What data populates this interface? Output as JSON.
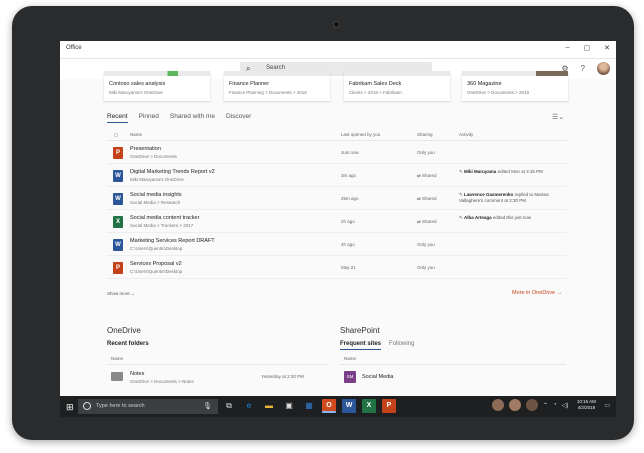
{
  "window": {
    "title": "Office",
    "controls": [
      "–",
      "▢",
      "✕"
    ]
  },
  "header": {
    "search_label": "Search",
    "search_icon": "search-icon",
    "icons": [
      "gear-icon",
      "help-icon"
    ],
    "help_glyph": "?",
    "gear_glyph": "⚙"
  },
  "recent_cards": [
    {
      "title": "Contoso sales analysis",
      "path": "Miki Maruyama's OneDrive"
    },
    {
      "title": "Finance Planner",
      "path": "Finance Planning > Documents > 2018"
    },
    {
      "title": "Fabrikam Sales Deck",
      "path": "Clients > 2018 > Fabrikam"
    },
    {
      "title": "360 Magazine",
      "path": "OneDrive > Documents > 2018"
    }
  ],
  "tabs": [
    {
      "label": "Recent",
      "active": true
    },
    {
      "label": "Pinned",
      "active": false
    },
    {
      "label": "Shared with me",
      "active": false
    },
    {
      "label": "Discover",
      "active": false
    }
  ],
  "table": {
    "headers": {
      "name": "Name",
      "opened": "Last opened by you",
      "sharing": "Sharing",
      "activity": "Activity"
    },
    "rows": [
      {
        "app": "P",
        "color": "#c4421a",
        "name": "Presentation",
        "path": "OneDrive > Documents",
        "opened": "Just now",
        "sharing": "Only you",
        "activity_who": "",
        "activity_what": ""
      },
      {
        "app": "W",
        "color": "#2b579a",
        "name": "Digital Marketing Trends Report v2",
        "path": "Miki Maruyama's OneDrive",
        "opened": "3m ago",
        "sharing": "Shared",
        "activity_who": "Miki Maruyama",
        "activity_what": "edited Mon at 3:15 PM"
      },
      {
        "app": "W",
        "color": "#2b579a",
        "name": "Social media insights",
        "path": "Social Media > Research",
        "opened": "25m ago",
        "sharing": "Shared",
        "activity_who": "Lawrence Gasmerenko",
        "activity_what": "replied to Maissa Vallaghere's comment at 2:30 PM"
      },
      {
        "app": "X",
        "color": "#217346",
        "name": "Social media content tracker",
        "path": "Social Media > Trackers > 2017",
        "opened": "2h ago",
        "sharing": "Shared",
        "activity_who": "Alba Arteaga",
        "activity_what": "edited this just now"
      },
      {
        "app": "W",
        "color": "#2b579a",
        "name": "Marketing Services Report DRAFT",
        "path": "C:\\Users\\Quentin\\Desktop",
        "opened": "4h ago",
        "sharing": "Only you",
        "activity_who": "",
        "activity_what": ""
      },
      {
        "app": "P",
        "color": "#c4421a",
        "name": "Services Proposal v2",
        "path": "C:\\Users\\Quentin\\Desktop",
        "opened": "May 21",
        "sharing": "Only you",
        "activity_who": "",
        "activity_what": ""
      }
    ]
  },
  "show_more": "Show more ⌄",
  "more_in_onedrive": "More in OneDrive →",
  "onedrive": {
    "title": "OneDrive",
    "subtitle": "Recent folders",
    "col_name": "Name",
    "folder": {
      "name": "Notes",
      "path": "OneDrive > Documents > Notes",
      "date": "Yesterday at 2:30 PM"
    }
  },
  "sharepoint": {
    "title": "SharePoint",
    "tabs": [
      {
        "label": "Frequent sites",
        "active": true
      },
      {
        "label": "Following",
        "active": false
      }
    ],
    "col_name": "Name",
    "site": {
      "initials": "SM",
      "name": "Social Media",
      "color": "#7b3f8a"
    }
  },
  "taskbar": {
    "search_placeholder": "Type here to search",
    "apps": [
      {
        "name": "task-view-icon",
        "glyph": "⧉",
        "color": "",
        "active": false
      },
      {
        "name": "edge-icon",
        "glyph": "e",
        "color": "#1e88e5",
        "active": false
      },
      {
        "name": "file-explorer-icon",
        "glyph": "▬",
        "color": "#e8b23a",
        "active": false
      },
      {
        "name": "store-icon",
        "glyph": "▣",
        "color": "",
        "active": false
      },
      {
        "name": "photos-icon",
        "glyph": "▦",
        "color": "#2f7dc9",
        "active": false
      },
      {
        "name": "office-icon",
        "glyph": "O",
        "color": "#d04a1e",
        "active": true
      },
      {
        "name": "word-icon",
        "glyph": "W",
        "color": "#2b579a",
        "active": false
      },
      {
        "name": "excel-icon",
        "glyph": "X",
        "color": "#217346",
        "active": false
      },
      {
        "name": "powerpoint-icon",
        "glyph": "P",
        "color": "#c4421a",
        "active": false
      }
    ],
    "time": "10:16 AM",
    "date": "4/2/2018"
  }
}
